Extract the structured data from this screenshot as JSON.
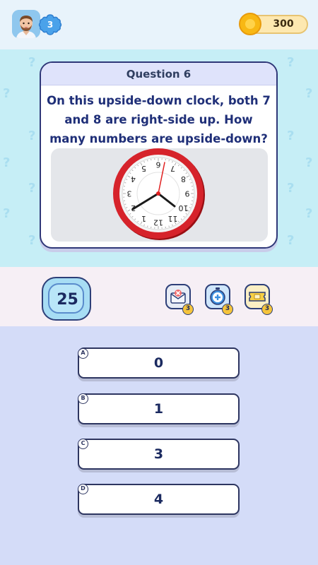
{
  "player": {
    "level": "3"
  },
  "coins": {
    "amount": "300"
  },
  "question": {
    "header": "Question 6",
    "text": "On this upside-down clock, both 7 and 8 are right-side up. How many numbers are upside-down?"
  },
  "clock_numbers": [
    "12",
    "1",
    "2",
    "3",
    "4",
    "5",
    "6",
    "7",
    "8",
    "9",
    "10",
    "11"
  ],
  "timer": {
    "seconds": "25"
  },
  "powerups": [
    {
      "icon": "envelope-x-icon",
      "count": "3"
    },
    {
      "icon": "stopwatch-plus-icon",
      "count": "3"
    },
    {
      "icon": "ticket-icon",
      "count": "3"
    }
  ],
  "answers": [
    {
      "letter": "A",
      "text": "0"
    },
    {
      "letter": "B",
      "text": "1"
    },
    {
      "letter": "C",
      "text": "3"
    },
    {
      "letter": "D",
      "text": "4"
    }
  ],
  "colors": {
    "accent": "#2d3f78",
    "clock_rim": "#d6232b",
    "coin": "#f8b814"
  }
}
